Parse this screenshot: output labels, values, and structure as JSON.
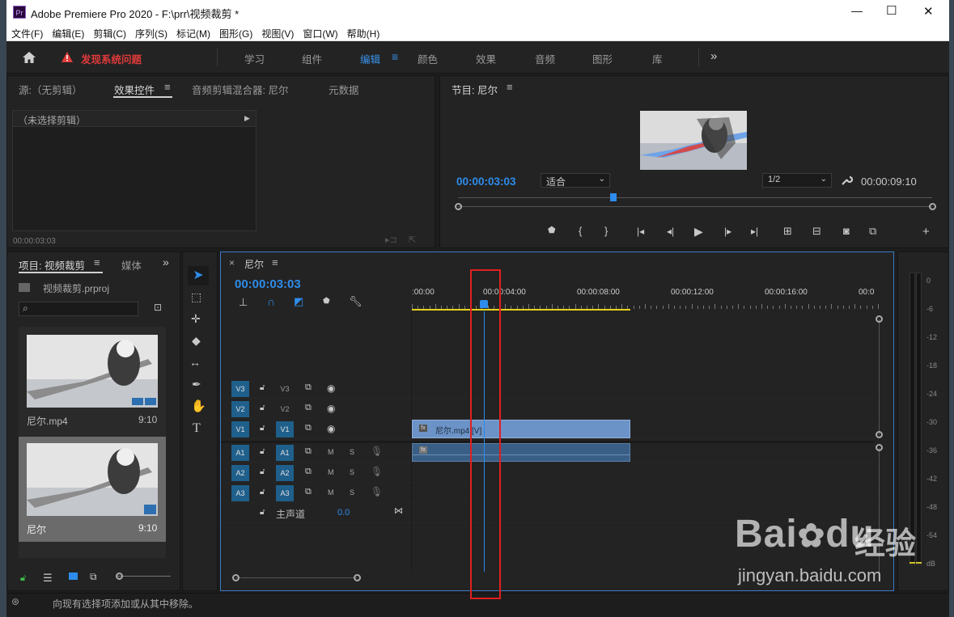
{
  "title_bar": {
    "app_icon": "Pr",
    "title": "Adobe Premiere Pro 2020 - F:\\prr\\视频裁剪 *",
    "minimize": "—",
    "maximize": "☐",
    "close": "✕"
  },
  "menu": [
    "文件(F)",
    "编辑(E)",
    "剪辑(C)",
    "序列(S)",
    "标记(M)",
    "图形(G)",
    "视图(V)",
    "窗口(W)",
    "帮助(H)"
  ],
  "workspace": {
    "warning": "发现系统问题",
    "tabs": [
      "学习",
      "组件",
      "编辑",
      "颜色",
      "效果",
      "音频",
      "图形",
      "库"
    ],
    "active_tab": "编辑",
    "more": "»"
  },
  "source_panel": {
    "tabs": [
      "源:（无剪辑）",
      "效果控件",
      "音频剪辑混合器: 尼尔",
      "元数据"
    ],
    "no_clip": "（未选择剪辑）",
    "timecode": "00:00:03:03"
  },
  "program_monitor": {
    "title": "节目: 尼尔",
    "timecode": "00:00:03:03",
    "fit": "适合",
    "resolution": "1/2",
    "duration": "00:00:09:10",
    "playhead_fraction": 0.32
  },
  "project_panel": {
    "tabs": [
      "项目: 视频裁剪",
      "媒体"
    ],
    "project_file": "视频裁剪.prproj",
    "items": [
      {
        "name": "尼尔.mp4",
        "duration": "9:10"
      },
      {
        "name": "尼尔",
        "duration": "9:10"
      }
    ]
  },
  "timeline": {
    "close": "×",
    "name": "尼尔",
    "timecode": "00:00:03:03",
    "ruler_labels": [
      ":00:00",
      "00:00:04:00",
      "00:00:08:00",
      "00:00:12:00",
      "00:00:16:00",
      "00:0"
    ],
    "video_tracks": [
      "V3",
      "V2",
      "V1"
    ],
    "audio_tracks": [
      "A1",
      "A2",
      "A3"
    ],
    "master": "主声道",
    "master_value": "0.0",
    "video_clip": "尼尔.mp4 [V]",
    "m": "M",
    "s": "S"
  },
  "audio_meter": {
    "labels": [
      "0",
      "-6",
      "-12",
      "-18",
      "-24",
      "-30",
      "-36",
      "-42",
      "-48",
      "-54",
      "dB"
    ]
  },
  "status_bar": {
    "message": "向现有选择项添加或从其中移除。"
  },
  "watermark": {
    "brand": "Bai",
    "brand2": "du",
    "cn": "经验",
    "url": "jingyan.baidu.com"
  },
  "colors": {
    "accent_blue": "#2d8ceb",
    "warning_red": "#e03a3a",
    "clip_video": "#6c93c7",
    "clip_audio": "#3a5f86",
    "highlight_box": "#e02020"
  }
}
